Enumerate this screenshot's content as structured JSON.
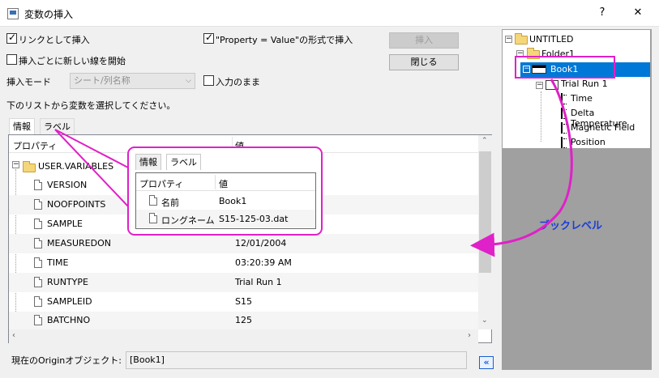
{
  "window": {
    "title": "変数の挿入",
    "help": "?",
    "close": "✕"
  },
  "options": {
    "link_insert": "リンクとして挿入",
    "property_value": "\"Property = Value\"の形式で挿入",
    "new_line": "挿入ごとに新しい線を開始",
    "insert_mode_label": "挿入モード",
    "insert_mode_value": "シート/列名称",
    "as_input": "入力のまま"
  },
  "buttons": {
    "insert": "挿入",
    "close": "閉じる"
  },
  "instruction": "下のリストから変数を選択してください。",
  "tabs": [
    "情報",
    "ラベル"
  ],
  "grid": {
    "col_property": "プロパティ",
    "col_value": "値",
    "root": "USER.VARIABLES",
    "rows": [
      {
        "name": "VERSION",
        "value": ""
      },
      {
        "name": "NOOFPOINTS",
        "value": ""
      },
      {
        "name": "SAMPLE",
        "value": ""
      },
      {
        "name": "MEASUREDON",
        "value": "12/01/2004"
      },
      {
        "name": "TIME",
        "value": "03:20:39 AM"
      },
      {
        "name": "RUNTYPE",
        "value": "Trial Run 1"
      },
      {
        "name": "SAMPLEID",
        "value": "S15"
      },
      {
        "name": "BATCHNO",
        "value": "125"
      }
    ]
  },
  "callout": {
    "tabs": [
      "情報",
      "ラベル"
    ],
    "col_property": "プロパティ",
    "col_value": "値",
    "rows": [
      {
        "name": "名前",
        "value": "Book1"
      },
      {
        "name": "ロングネーム",
        "value": "S15-125-03.dat"
      }
    ]
  },
  "tree": {
    "root": "UNTITLED",
    "folder": "Folder1",
    "book": "Book1",
    "sheet": "Trial Run 1",
    "columns": [
      "Time",
      "Delta Temperature",
      "Magnetic Field",
      "Position"
    ]
  },
  "annotation": "ブックレベル",
  "status": {
    "label": "現在のOriginオブジェクト:",
    "value": "[Book1]",
    "collapse": "«"
  },
  "colors": {
    "accent": "#e020c8",
    "selection": "#0078d7",
    "annotation": "#1a3dd8"
  }
}
